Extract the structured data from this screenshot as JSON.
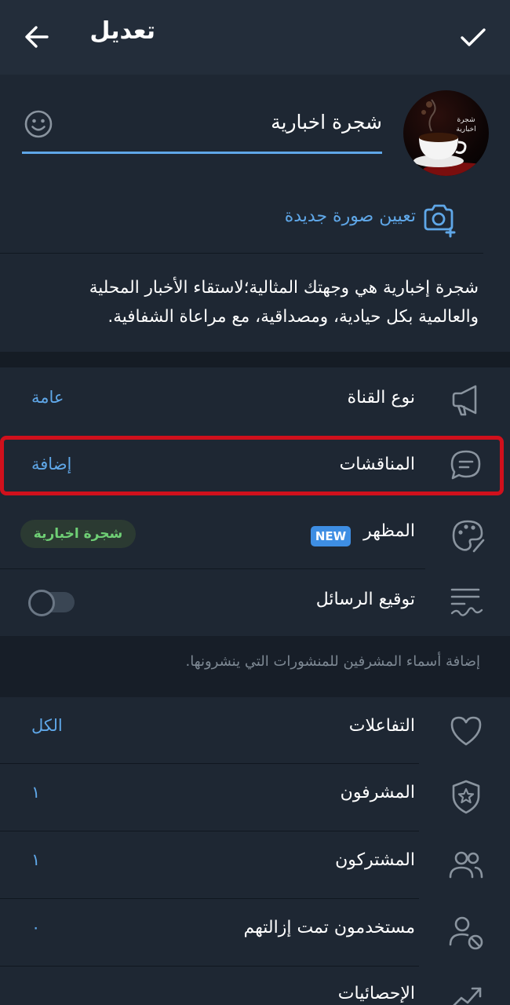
{
  "header": {
    "title": "تعديل"
  },
  "channel": {
    "name": "شجرة اخبارية",
    "avatar_caption": "شجرة\nاخبارية",
    "set_photo_label": "تعيين صورة جديدة",
    "description": "شجرة إخبارية هي وجهتك المثالية؛لاستقاء الأخبار المحلية والعالمية بكل حيادية، ومصداقية، مع مراعاة الشفافية."
  },
  "settings": {
    "channel_type": {
      "label": "نوع القناة",
      "value": "عامة"
    },
    "discussions": {
      "label": "المناقشات",
      "value": "إضافة"
    },
    "appearance": {
      "label": "المظهر",
      "badge": "NEW",
      "value": "شجرة اخبارية"
    },
    "sign_messages": {
      "label": "توقيع الرسائل",
      "enabled": false
    }
  },
  "sign_hint": "إضافة أسماء المشرفين للمنشورات التي ينشرونها.",
  "management": {
    "reactions": {
      "label": "التفاعلات",
      "value": "الكل"
    },
    "admins": {
      "label": "المشرفون",
      "value": "١"
    },
    "subscribers": {
      "label": "المشتركون",
      "value": "١"
    },
    "removed": {
      "label": "مستخدمون تمت إزالتهم",
      "value": "٠"
    },
    "statistics": {
      "label": "الإحصائيات"
    }
  },
  "colors": {
    "accent": "#5fa7e8",
    "highlight": "#d0101c",
    "badge_bg": "#3e8ee3",
    "chip_bg": "#2b3a32",
    "chip_text": "#6fcf75"
  }
}
